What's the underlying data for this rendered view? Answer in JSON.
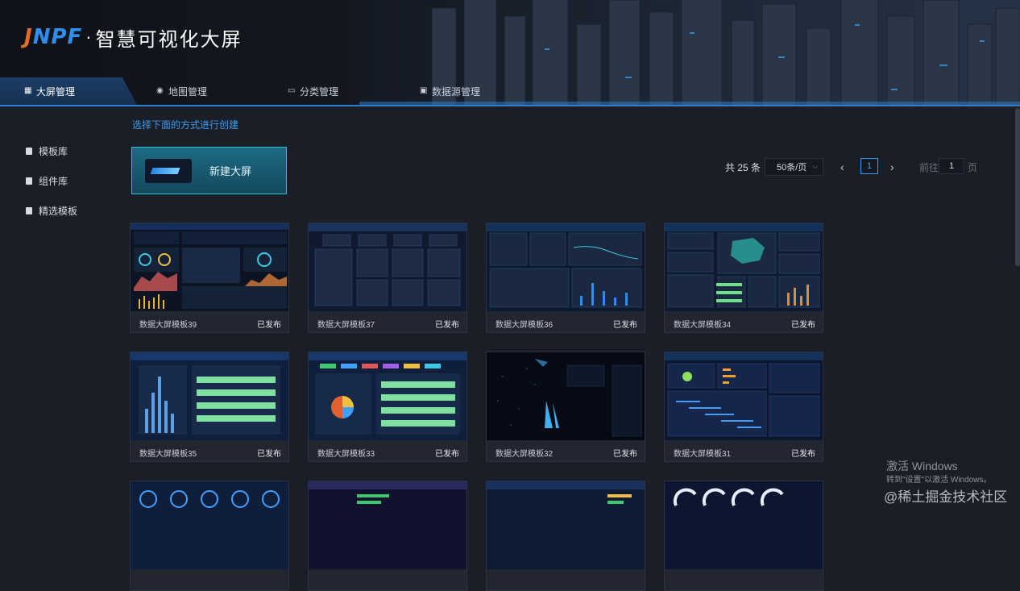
{
  "header": {
    "logo_brand_left": "J",
    "logo_brand_mid": "N",
    "logo_brand_right": "PF",
    "logo_sep": "·",
    "logo_name": "智慧可视化大屏"
  },
  "nav": {
    "items": [
      {
        "label": "大屏管理",
        "icon": "grid-icon",
        "active": true
      },
      {
        "label": "地图管理",
        "icon": "map-pin-icon",
        "active": false
      },
      {
        "label": "分类管理",
        "icon": "folder-icon",
        "active": false
      },
      {
        "label": "数据源管理",
        "icon": "database-icon",
        "active": false
      }
    ]
  },
  "sidebar": {
    "items": [
      {
        "label": "模板库",
        "icon": "doc-icon"
      },
      {
        "label": "组件库",
        "icon": "doc-icon"
      },
      {
        "label": "精选模板",
        "icon": "doc-icon"
      }
    ]
  },
  "main": {
    "hint": "选择下面的方式进行创建",
    "create_label": "新建大屏"
  },
  "pagination": {
    "total": "共 25 条",
    "page_size": "50条/页",
    "prev": "‹",
    "current_page": "1",
    "next": "›",
    "goto_label": "前往",
    "goto_value": "1",
    "goto_unit": "页"
  },
  "cards": [
    {
      "name": "数据大屏模板39",
      "status": "已发布"
    },
    {
      "name": "数据大屏模板37",
      "status": "已发布"
    },
    {
      "name": "数据大屏模板36",
      "status": "已发布"
    },
    {
      "name": "数据大屏模板34",
      "status": "已发布"
    },
    {
      "name": "数据大屏模板35",
      "status": "已发布"
    },
    {
      "name": "数据大屏模板33",
      "status": "已发布"
    },
    {
      "name": "数据大屏模板32",
      "status": "已发布"
    },
    {
      "name": "数据大屏模板31",
      "status": "已发布"
    }
  ],
  "overlay": {
    "activate_title": "激活 Windows",
    "activate_sub": "转到\"设置\"以激活 Windows。",
    "juejin": "@稀土掘金技术社区"
  },
  "colors": {
    "accent": "#3a9cf0",
    "create_border": "#2ec0d8",
    "brand_orange": "#e06b2b",
    "brand_blue": "#2e8ff0"
  }
}
